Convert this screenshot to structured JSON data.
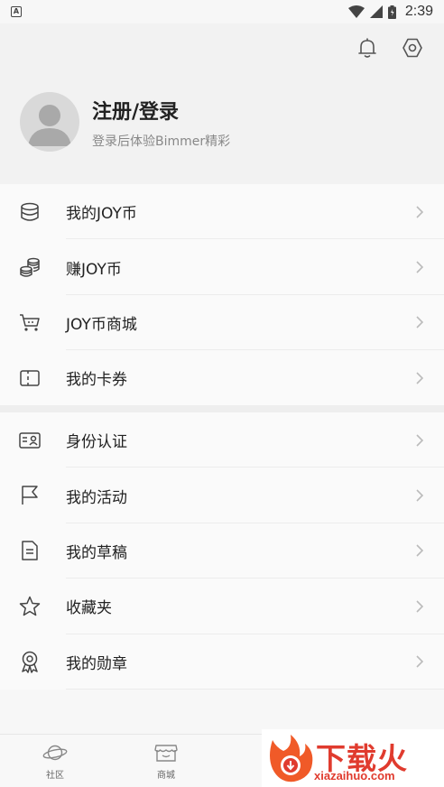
{
  "status_bar": {
    "time": "2:39",
    "app_badge": "A"
  },
  "profile": {
    "title": "注册/登录",
    "subtitle": "登录后体验Bimmer精彩"
  },
  "menu_group_1": [
    {
      "label": "我的JOY币",
      "icon": "database-icon"
    },
    {
      "label": "赚JOY币",
      "icon": "coins-icon"
    },
    {
      "label": "JOY币商城",
      "icon": "cart-icon"
    },
    {
      "label": "我的卡券",
      "icon": "ticket-icon"
    }
  ],
  "menu_group_2": [
    {
      "label": "身份认证",
      "icon": "id-card-icon"
    },
    {
      "label": "我的活动",
      "icon": "flag-icon"
    },
    {
      "label": "我的草稿",
      "icon": "document-icon"
    },
    {
      "label": "收藏夹",
      "icon": "star-icon"
    },
    {
      "label": "我的勋章",
      "icon": "medal-icon"
    }
  ],
  "bottom_nav": [
    {
      "label": "社区",
      "icon": "planet-icon"
    },
    {
      "label": "商城",
      "icon": "store-icon"
    }
  ],
  "watermark": {
    "brand": "下载火",
    "url": "xiazaihuo.com"
  }
}
